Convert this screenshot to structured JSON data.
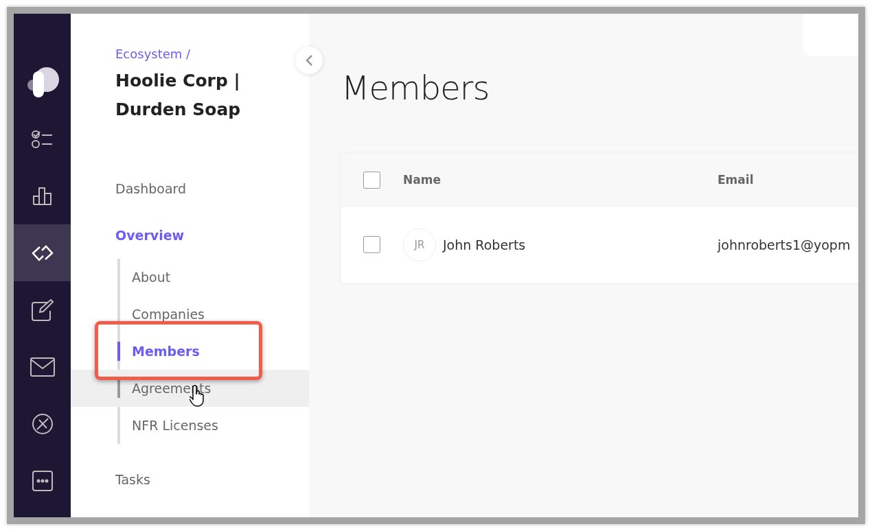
{
  "rail": [
    {
      "kind": "logo",
      "selected": false
    },
    {
      "kind": "checklist",
      "selected": false
    },
    {
      "kind": "chart",
      "selected": false
    },
    {
      "kind": "link",
      "selected": true
    },
    {
      "kind": "edit",
      "selected": false
    },
    {
      "kind": "mail",
      "selected": false
    },
    {
      "kind": "cancel",
      "selected": false
    },
    {
      "kind": "more",
      "selected": false
    }
  ],
  "nav": {
    "breadcrumb": "Ecosystem /",
    "title": "Hoolie Corp | Durden Soap",
    "items": [
      {
        "label": "Dashboard",
        "selected": false
      },
      {
        "label": "Overview",
        "selected": true,
        "children": [
          {
            "label": "About",
            "selected": false,
            "hovered": false
          },
          {
            "label": "Companies",
            "selected": false,
            "hovered": false
          },
          {
            "label": "Members",
            "selected": true,
            "hovered": false
          },
          {
            "label": "Agreements",
            "selected": false,
            "hovered": true
          },
          {
            "label": "NFR Licenses",
            "selected": false,
            "hovered": false
          }
        ]
      },
      {
        "label": "Tasks",
        "selected": false
      }
    ]
  },
  "page": {
    "title": "Members",
    "table": {
      "columns": [
        "Name",
        "Email"
      ],
      "header_checked": false,
      "rows": [
        {
          "checked": false,
          "initials": "JR",
          "name": "John Roberts",
          "email": "johnroberts1@yopm"
        }
      ]
    }
  }
}
